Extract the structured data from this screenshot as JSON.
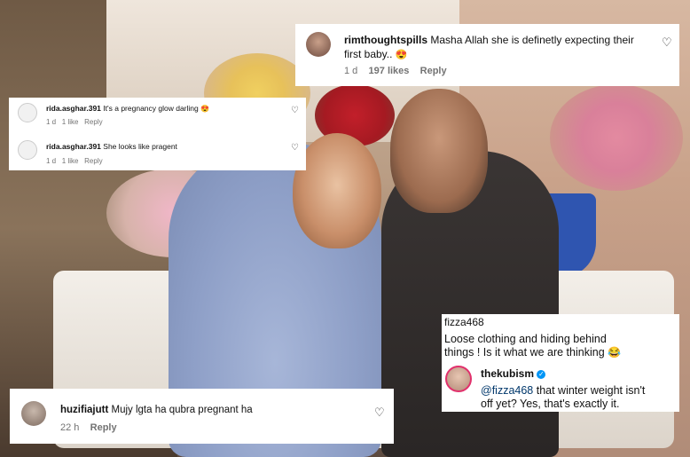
{
  "comments": {
    "rim": {
      "username": "rimthoughtspills",
      "text_line1": "Masha Allah she is definetly expecting their",
      "text_line2": "first baby..",
      "emoji": "😍",
      "age": "1 d",
      "likes": "197 likes",
      "reply": "Reply"
    },
    "rida1": {
      "username": "rida.asghar.391",
      "text": "It's a pregnancy glow darling",
      "emoji": "😍",
      "age": "1 d",
      "likes": "1 like",
      "reply": "Reply"
    },
    "rida2": {
      "username": "rida.asghar.391",
      "text": "She looks like pragent",
      "age": "1 d",
      "likes": "1 like",
      "reply": "Reply"
    },
    "huzifia": {
      "username": "huzifiajutt",
      "text": "Mujy lgta ha qubra pregnant ha",
      "age": "22 h",
      "reply": "Reply"
    },
    "fizza": {
      "username": "fizza468",
      "text_line1": "Loose clothing and hiding behind",
      "text_line2": "things !  Is it what we are thinking",
      "emoji": "😂",
      "reply_username": "thekubism",
      "reply_mention": "@fizza468",
      "reply_text_line1": " that winter weight isn't",
      "reply_text_line2": "off yet? Yes, that's exactly it."
    }
  },
  "colors": {
    "card_bg": "#ffffff",
    "meta_gray": "#737373",
    "mention_blue": "#00376b",
    "verified_blue": "#0095f6"
  },
  "icons": [
    "heart-icon",
    "verified-badge-icon"
  ]
}
